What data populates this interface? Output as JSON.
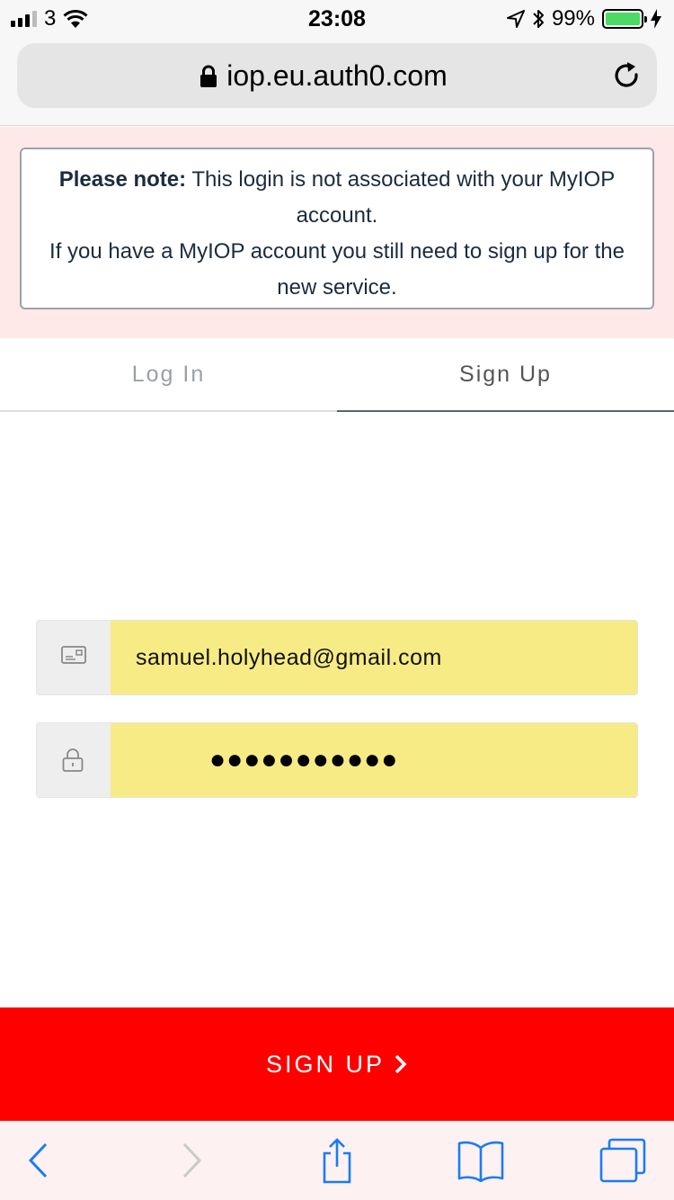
{
  "status_bar": {
    "carrier": "3",
    "time": "23:08",
    "battery_percent": "99%",
    "battery_level": 0.99,
    "battery_color": "#4cd964"
  },
  "browser": {
    "url": "iop.eu.auth0.com",
    "icons": [
      "lock-icon",
      "reload-icon"
    ]
  },
  "notice": {
    "bold_prefix": "Please note:",
    "line1": "This login is not associated with your MyIOP account.",
    "line2": "If you have a MyIOP account you still need to sign up for the new service."
  },
  "tabs": [
    {
      "label": "Log In",
      "active": false
    },
    {
      "label": "Sign Up",
      "active": true
    }
  ],
  "form": {
    "email": {
      "icon": "email-icon",
      "value": "samuel.holyhead@gmail.com"
    },
    "password": {
      "icon": "lock-icon",
      "masked_value": "●●●●●●●●●●●"
    },
    "submit_label": "SIGN UP",
    "submit_color": "#ff0000",
    "autofill_color": "#f7eb85"
  },
  "toolbar": {
    "items": [
      "back-icon",
      "forward-icon",
      "share-icon",
      "bookmarks-icon",
      "tabs-icon"
    ],
    "accent": "#1a7cf5"
  }
}
